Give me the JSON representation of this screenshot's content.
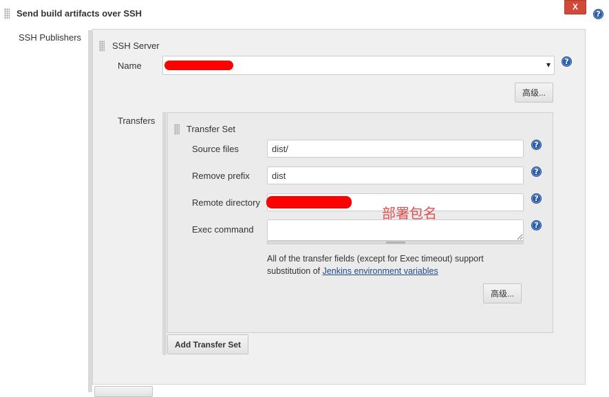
{
  "section": {
    "title": "Send build artifacts over SSH",
    "delete_label": "X"
  },
  "ssh_publishers": {
    "label": "SSH Publishers",
    "server": {
      "title": "SSH Server",
      "name_label": "Name",
      "advanced_label": "高级..."
    },
    "transfers": {
      "label": "Transfers",
      "transfer_set": {
        "title": "Transfer Set",
        "source_files_label": "Source files",
        "source_files_value": "dist/",
        "remove_prefix_label": "Remove prefix",
        "remove_prefix_value": "dist",
        "remote_directory_label": "Remote directory",
        "exec_command_label": "Exec command",
        "exec_command_value": "",
        "note_prefix": "All of the transfer fields (except for Exec timeout) support substitution of ",
        "note_link": "Jenkins environment variables",
        "advanced_label": "高级...",
        "annotation": "部署包名"
      },
      "add_label": "Add Transfer Set"
    }
  },
  "icons": {
    "help": "?",
    "dropdown": "▾"
  },
  "colors": {
    "delete_button": "#d24939",
    "help_icon": "#2b5ca8",
    "redaction": "#ff0000",
    "annotation": "#e05050",
    "link": "#204a87"
  }
}
